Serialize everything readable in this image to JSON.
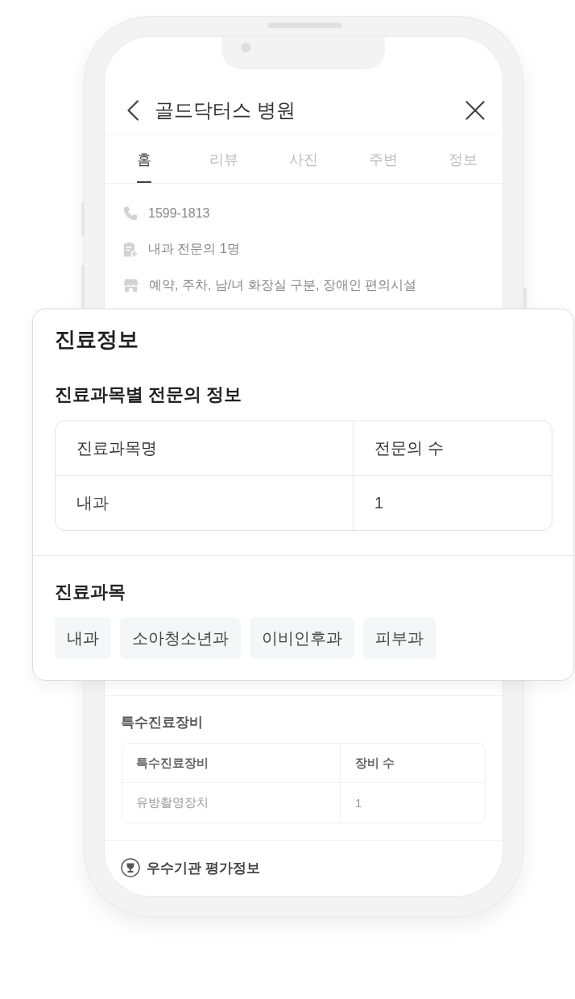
{
  "header": {
    "title": "골드닥터스 병원"
  },
  "tabs": [
    {
      "label": "홈",
      "selected": true
    },
    {
      "label": "리뷰",
      "selected": false
    },
    {
      "label": "사진",
      "selected": false
    },
    {
      "label": "주변",
      "selected": false
    },
    {
      "label": "정보",
      "selected": false
    }
  ],
  "info_rows": [
    {
      "kind": "phone",
      "text": "1599-1813"
    },
    {
      "kind": "doctors",
      "text": "내과 전문의 1명"
    },
    {
      "kind": "facilities",
      "text": "예약, 주차, 남/녀 화장실 구분, 장애인 편의시설"
    }
  ],
  "detail_card": {
    "title": "진료정보",
    "specialist_table": {
      "title": "진료과목별 전문의 정보",
      "columns": [
        "진료과목명",
        "전문의 수"
      ],
      "rows": [
        [
          "내과",
          "1"
        ]
      ]
    },
    "departments": {
      "title": "진료과목",
      "tags": [
        "내과",
        "소아청소년과",
        "이비인후과",
        "피부과"
      ]
    }
  },
  "equipment": {
    "title": "특수진료장비",
    "columns": [
      "특수진료장비",
      "장비 수"
    ],
    "rows": [
      [
        "유방촬영장치",
        "1"
      ]
    ]
  },
  "evaluation_link": {
    "label": "우수기관 평가정보"
  }
}
